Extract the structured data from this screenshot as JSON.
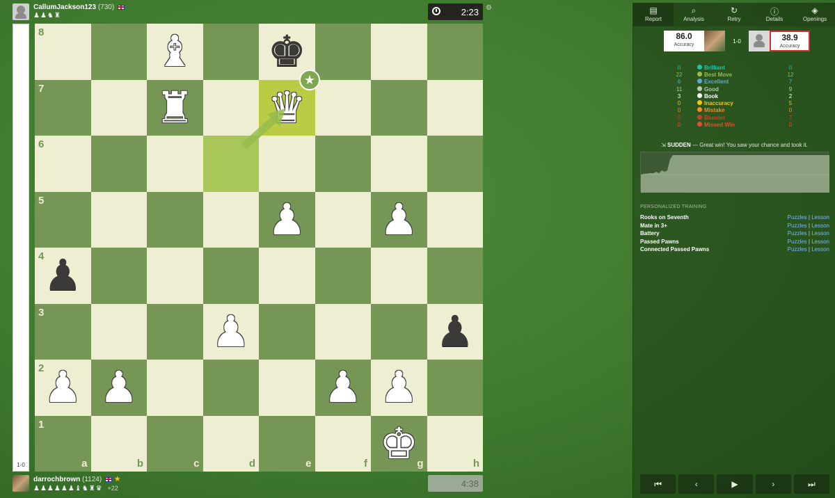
{
  "top_player": {
    "name": "CallumJackson123",
    "rating": "(730)",
    "captured": "♟♟♞♜"
  },
  "bottom_player": {
    "name": "darrochbrown",
    "rating": "(1124)",
    "captured": "♟♟♟♟♟♟♝♞♜♛",
    "advantage": "+22"
  },
  "clocks": {
    "top": "2:23",
    "bottom": "4:38"
  },
  "eval": {
    "text": "1-0",
    "fill": 1.0
  },
  "board": {
    "ranks": [
      "8",
      "7",
      "6",
      "5",
      "4",
      "3",
      "2",
      "1"
    ],
    "files": [
      "a",
      "b",
      "c",
      "d",
      "e",
      "f",
      "g",
      "h"
    ],
    "pieces": {
      "c8": "wB",
      "e8": "bK",
      "c7": "wR",
      "e7": "wQ",
      "e5": "wP",
      "g5": "wP",
      "a4": "bP",
      "d3": "wP",
      "h3": "bP",
      "a2": "wP",
      "b2": "wP",
      "f2": "wP",
      "g2": "wP",
      "g1": "wK"
    },
    "last_move": {
      "from": "d6",
      "to": "e7"
    },
    "badge": "best-move-star"
  },
  "tabs": [
    {
      "label": "Report",
      "icon": "report-icon"
    },
    {
      "label": "Analysis",
      "icon": "analysis-icon"
    },
    {
      "label": "Retry",
      "icon": "retry-icon"
    },
    {
      "label": "Details",
      "icon": "details-icon"
    },
    {
      "label": "Openings",
      "icon": "openings-icon"
    }
  ],
  "accuracy": {
    "left": {
      "value": "86.0",
      "label": "Accuracy"
    },
    "right": {
      "value": "38.9",
      "label": "Accuracy"
    },
    "result": "1-0"
  },
  "classifications": [
    {
      "name": "Brilliant",
      "left": "0",
      "right": "0",
      "color": "#26c2a3"
    },
    {
      "name": "Best Move",
      "left": "22",
      "right": "12",
      "color": "#96bc4b"
    },
    {
      "name": "Excellent",
      "left": "6",
      "right": "7",
      "color": "#5fa9d8"
    },
    {
      "name": "Good",
      "left": "11",
      "right": "9",
      "color": "#b6c7ac"
    },
    {
      "name": "Book",
      "left": "3",
      "right": "2",
      "color": "#ffffff"
    },
    {
      "name": "Inaccuracy",
      "left": "0",
      "right": "5",
      "color": "#f0c419"
    },
    {
      "name": "Mistake",
      "left": "0",
      "right": "0",
      "color": "#f08c2a"
    },
    {
      "name": "Blunder",
      "left": "0",
      "right": "7",
      "color": "#c3422f"
    },
    {
      "name": "Missed Win",
      "left": "0",
      "right": "0",
      "color": "#e0522f"
    }
  ],
  "feedback": {
    "title": "SUDDEN",
    "text": "— Great win! You saw your chance and took it."
  },
  "training": {
    "heading": "PERSONALIZED TRAINING",
    "items": [
      {
        "name": "Rooks on Seventh",
        "puzzles": "Puzzles",
        "lesson": "Lesson"
      },
      {
        "name": "Mate in 3+",
        "puzzles": "Puzzles",
        "lesson": "Lesson"
      },
      {
        "name": "Battery",
        "puzzles": "Puzzles",
        "lesson": "Lesson"
      },
      {
        "name": "Passed Pawns",
        "puzzles": "Puzzles",
        "lesson": "Lesson"
      },
      {
        "name": "Connected Passed Pawns",
        "puzzles": "Puzzles",
        "lesson": "Lesson"
      }
    ]
  },
  "controls": {
    "first": "⏮",
    "prev": "‹",
    "play": "▶",
    "next": "›",
    "last": "⏭"
  }
}
